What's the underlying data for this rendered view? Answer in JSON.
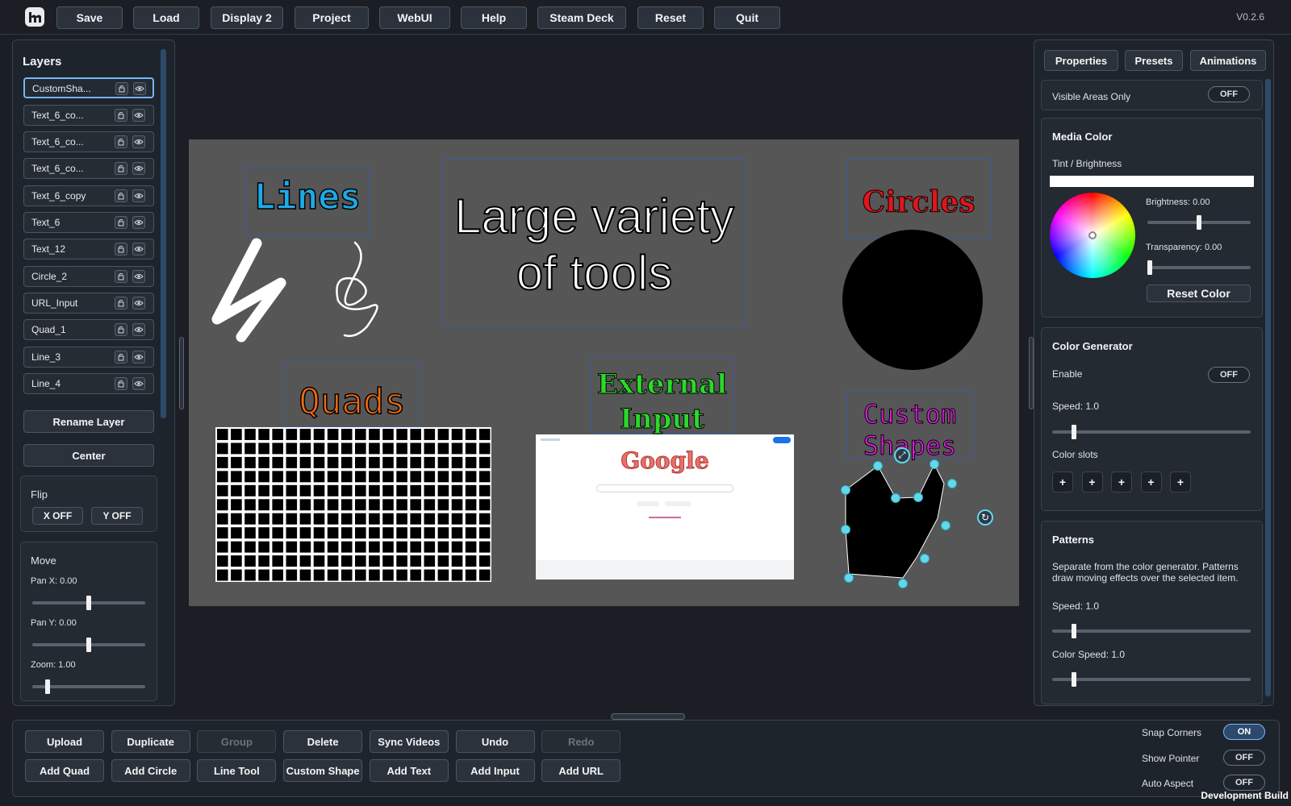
{
  "app": {
    "version": "V0.2.6",
    "build": "Development Build"
  },
  "topbar": {
    "buttons": [
      "Save",
      "Load",
      "Display 2",
      "Project",
      "WebUI",
      "Help",
      "Steam Deck",
      "Reset",
      "Quit"
    ]
  },
  "layers": {
    "title": "Layers",
    "items": [
      "CustomSha...",
      "Text_6_co...",
      "Text_6_co...",
      "Text_6_co...",
      "Text_6_copy",
      "Text_6",
      "Text_12",
      "Circle_2",
      "URL_Input",
      "Quad_1",
      "Line_3",
      "Line_4"
    ],
    "rename": "Rename Layer",
    "center": "Center",
    "flip": {
      "title": "Flip",
      "x": "X OFF",
      "y": "Y OFF"
    },
    "move": {
      "title": "Move",
      "pan_x": "Pan X: 0.00",
      "pan_y": "Pan Y: 0.00",
      "zoom": "Zoom: 1.00",
      "pan_x_value": 0.5,
      "pan_y_value": 0.5,
      "zoom_value": 0.12
    }
  },
  "canvas": {
    "lines_label": "Lines",
    "headline_1": "Large variety",
    "headline_2": "of tools",
    "circles_label": "Circles",
    "quads_label": "Quads",
    "external_1": "External",
    "external_2": "Input",
    "custom_1": "Custom",
    "custom_2": "Shapes",
    "colors": {
      "lines": "#1fa9e6",
      "circles": "#e0161b",
      "quads": "#ef6a14",
      "external": "#2bd82b",
      "custom": "#e31ee3"
    },
    "google_logo": "Google"
  },
  "right": {
    "tabs": [
      "Properties",
      "Presets",
      "Animations"
    ],
    "visible_areas": {
      "label": "Visible Areas Only",
      "state": "OFF"
    },
    "media_color": {
      "title": "Media Color",
      "tint": "Tint / Brightness",
      "brightness": "Brightness: 0.00",
      "transparency": "Transparency: 0.00",
      "reset": "Reset Color",
      "brightness_value": 0.5,
      "transparency_value": 0.0
    },
    "color_gen": {
      "title": "Color Generator",
      "enable": "Enable",
      "state": "OFF",
      "speed": "Speed: 1.0",
      "slots_label": "Color slots",
      "slot": "+",
      "speed_value": 0.1
    },
    "patterns": {
      "title": "Patterns",
      "desc": "Separate from the color generator. Patterns draw moving effects over the selected item.",
      "speed": "Speed: 1.0",
      "color_speed": "Color Speed: 1.0",
      "speed_value": 0.1,
      "color_speed_value": 0.1
    }
  },
  "bottom": {
    "row1": [
      "Upload",
      "Duplicate",
      "Group",
      "Delete",
      "Sync Videos",
      "Undo",
      "Redo"
    ],
    "row2": [
      "Add Quad",
      "Add Circle",
      "Line Tool",
      "Custom Shape",
      "Add Text",
      "Add Input",
      "Add URL"
    ],
    "snap": {
      "label": "Snap Corners",
      "state": "ON"
    },
    "pointer": {
      "label": "Show Pointer",
      "state": "OFF"
    },
    "aspect": {
      "label": "Auto Aspect",
      "state": "OFF"
    }
  }
}
